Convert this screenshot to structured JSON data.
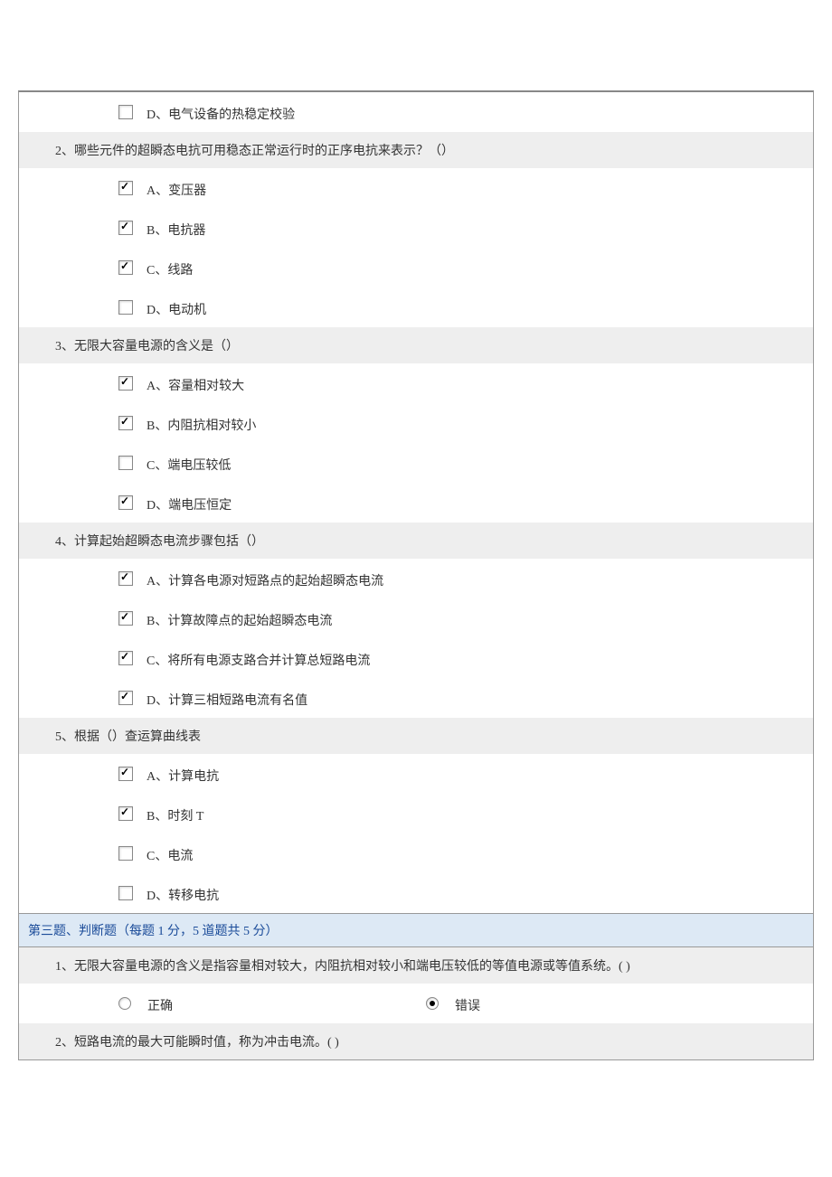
{
  "partial_q1": {
    "options": [
      {
        "key": "D",
        "label": "D、电气设备的热稳定校验",
        "checked": false
      }
    ]
  },
  "q2": {
    "text": "2、哪些元件的超瞬态电抗可用稳态正常运行时的正序电抗来表示？（）",
    "options": [
      {
        "key": "A",
        "label": "A、变压器",
        "checked": true
      },
      {
        "key": "B",
        "label": "B、电抗器",
        "checked": true
      },
      {
        "key": "C",
        "label": "C、线路",
        "checked": true
      },
      {
        "key": "D",
        "label": "D、电动机",
        "checked": false
      }
    ]
  },
  "q3": {
    "text": "3、无限大容量电源的含义是（）",
    "options": [
      {
        "key": "A",
        "label": "A、容量相对较大",
        "checked": true
      },
      {
        "key": "B",
        "label": "B、内阻抗相对较小",
        "checked": true
      },
      {
        "key": "C",
        "label": "C、端电压较低",
        "checked": false
      },
      {
        "key": "D",
        "label": "D、端电压恒定",
        "checked": true
      }
    ]
  },
  "q4": {
    "text": "4、计算起始超瞬态电流步骤包括（）",
    "options": [
      {
        "key": "A",
        "label": "A、计算各电源对短路点的起始超瞬态电流",
        "checked": true
      },
      {
        "key": "B",
        "label": "B、计算故障点的起始超瞬态电流",
        "checked": true
      },
      {
        "key": "C",
        "label": "C、将所有电源支路合并计算总短路电流",
        "checked": true
      },
      {
        "key": "D",
        "label": "D、计算三相短路电流有名值",
        "checked": true
      }
    ]
  },
  "q5": {
    "text": "5、根据（）查运算曲线表",
    "options": [
      {
        "key": "A",
        "label": "A、计算电抗",
        "checked": true
      },
      {
        "key": "B",
        "label": "B、时刻 T",
        "checked": true
      },
      {
        "key": "C",
        "label": "C、电流",
        "checked": false
      },
      {
        "key": "D",
        "label": "D、转移电抗",
        "checked": false
      }
    ]
  },
  "section3": {
    "header": "第三题、判断题（每题 1 分，5 道题共 5 分）",
    "q1": {
      "text": "1、无限大容量电源的含义是指容量相对较大，内阻抗相对较小和端电压较低的等值电源或等值系统。( )",
      "true_label": "正确",
      "false_label": "错误",
      "selected": "false"
    },
    "q2": {
      "text": "2、短路电流的最大可能瞬时值，称为冲击电流。( )"
    }
  }
}
